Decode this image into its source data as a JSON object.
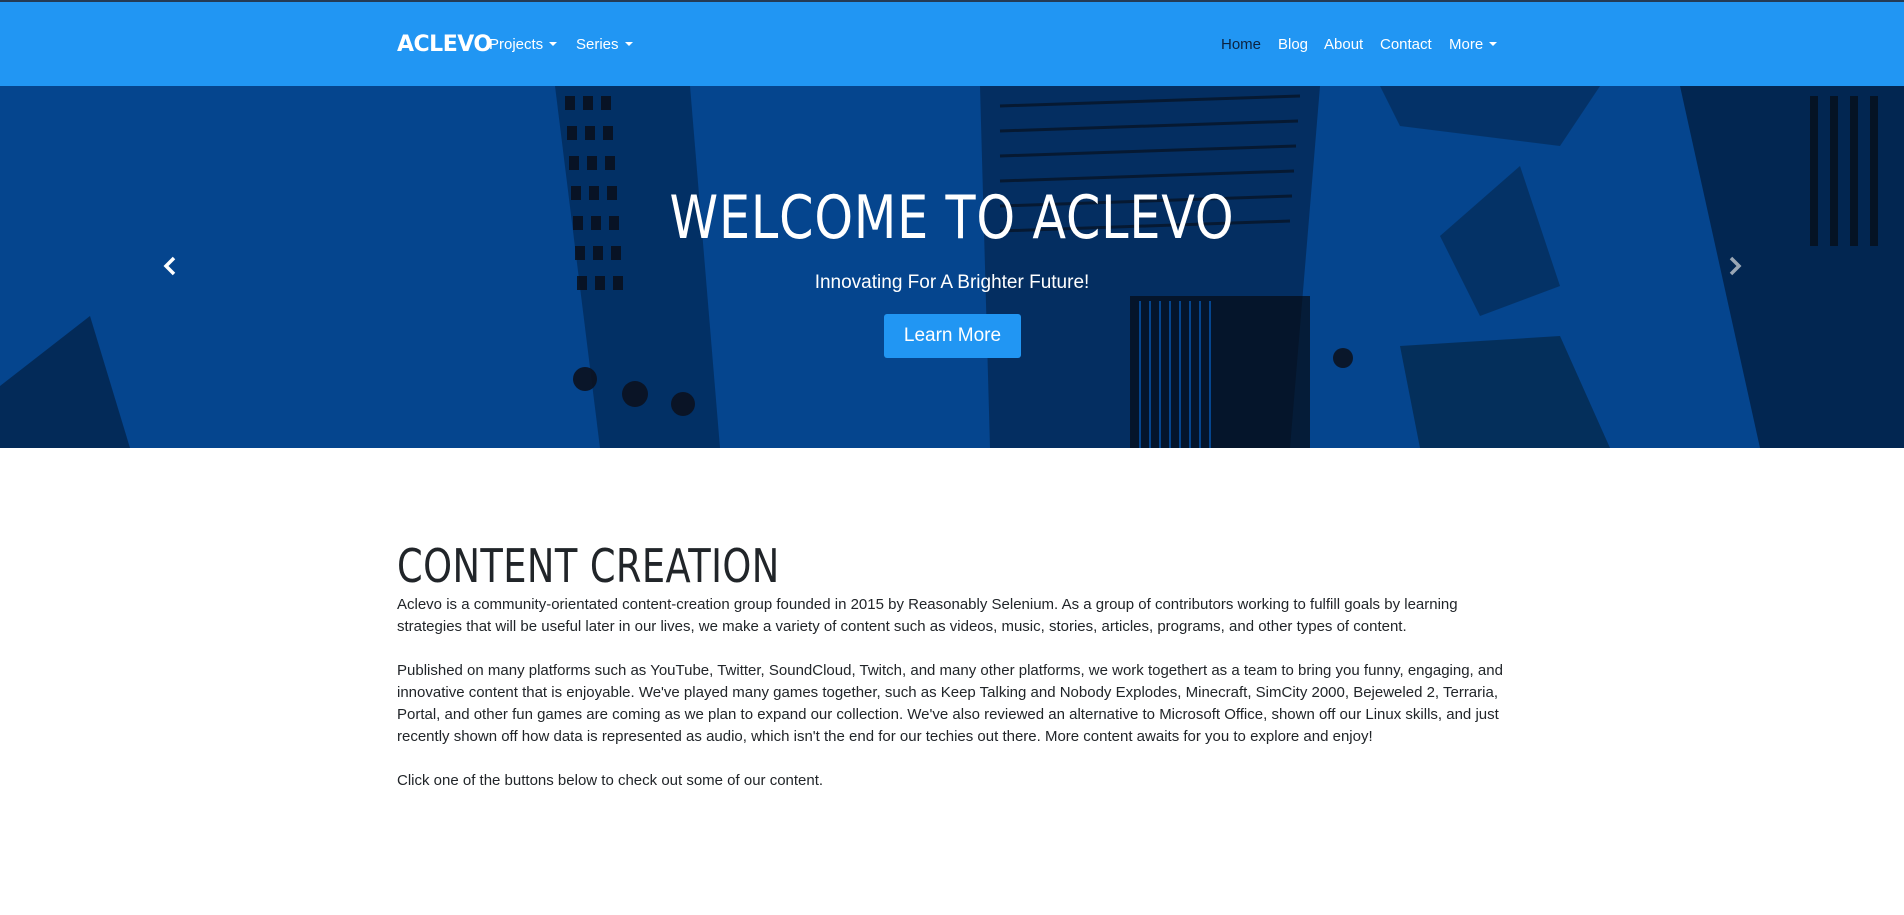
{
  "navbar": {
    "brand": "ACLEVO",
    "left_items": [
      {
        "label": "Projects"
      },
      {
        "label": "Series"
      }
    ],
    "right_items": [
      {
        "label": "Home"
      },
      {
        "label": "Blog"
      },
      {
        "label": "About"
      },
      {
        "label": "Contact"
      },
      {
        "label": "More"
      }
    ],
    "active": "Home",
    "color": "#2196f3"
  },
  "hero": {
    "title": "WELCOME TO ACLEVO",
    "subtitle": "Innovating For A Brighter Future!",
    "button_label": "Learn More",
    "background_color": "#05458e",
    "prev_icon": "chevron-left-icon",
    "next_icon": "chevron-right-icon"
  },
  "content": {
    "heading": "CONTENT CREATION",
    "paragraphs": [
      "Aclevo is a community-orientated content-creation group founded in 2015 by Reasonably Selenium. As a group of contributors working to fulfill goals by learning strategies that will be useful later in our lives, we make a variety of content such as videos, music, stories, articles, programs, and other types of content.",
      "Published on many platforms such as YouTube, Twitter, SoundCloud, Twitch, and many other platforms, we work togethert as a team to bring you funny, engaging, and innovative content that is enjoyable. We've played many games together, such as Keep Talking and Nobody Explodes, Minecraft, SimCity 2000, Bejeweled 2, Terraria, Portal, and other fun games are coming as we plan to expand our collection. We've also reviewed an alternative to Microsoft Office, shown off our Linux skills, and just recently shown off how data is represented as audio, which isn't the end for our techies out there. More content awaits for you to explore and enjoy!",
      "Click one of the buttons below to check out some of our content."
    ]
  }
}
